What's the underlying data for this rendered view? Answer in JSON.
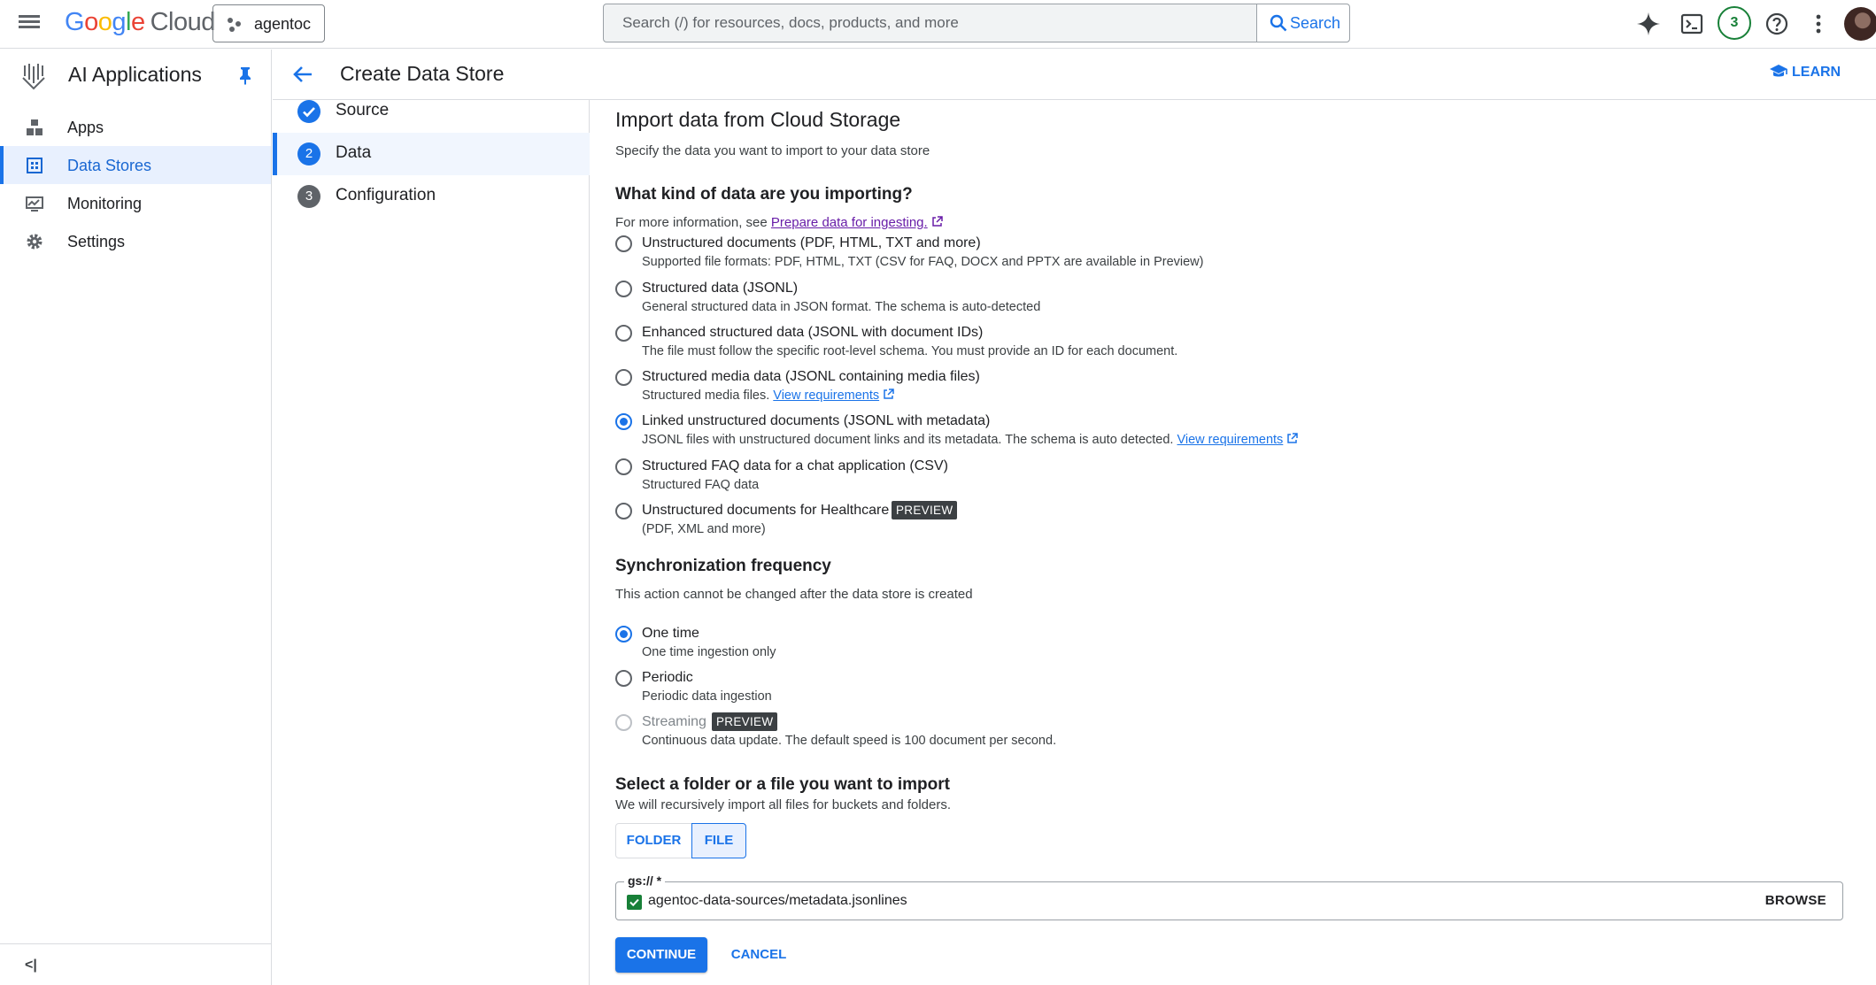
{
  "topbar": {
    "logo": {
      "g": "G",
      "o1": "o",
      "o2": "o",
      "g2": "g",
      "l": "l",
      "e": "e",
      "cloud": "Cloud"
    },
    "project": "agentoc",
    "search_placeholder": "Search (/) for resources, docs, products, and more",
    "search_button": "Search",
    "notifications_count": "3"
  },
  "leftnav": {
    "product_title": "AI Applications",
    "items": [
      {
        "label": "Apps",
        "icon": "apps-icon",
        "active": false
      },
      {
        "label": "Data Stores",
        "icon": "data-stores-icon",
        "active": true
      },
      {
        "label": "Monitoring",
        "icon": "monitoring-icon",
        "active": false
      },
      {
        "label": "Settings",
        "icon": "gear-icon",
        "active": false
      }
    ],
    "collapse": "<|"
  },
  "header": {
    "title": "Create Data Store",
    "learn": "LEARN"
  },
  "steps": [
    {
      "number": "",
      "label": "Source",
      "state": "done"
    },
    {
      "number": "2",
      "label": "Data",
      "state": "active"
    },
    {
      "number": "3",
      "label": "Configuration",
      "state": "todo"
    }
  ],
  "main": {
    "title": "Import data from Cloud Storage",
    "subtitle": "Specify the data you want to import to your data store",
    "kind_heading": "What kind of data are you importing?",
    "kind_info_prefix": "For more information, see ",
    "kind_info_link": "Prepare data for ingesting.",
    "options": [
      {
        "label": "Unstructured documents (PDF, HTML, TXT and more)",
        "desc": "Supported file formats: PDF, HTML, TXT (CSV for FAQ, DOCX and PPTX are available in Preview)",
        "checked": false
      },
      {
        "label": "Structured data (JSONL)",
        "desc": "General structured data in JSON format. The schema is auto-detected",
        "checked": false
      },
      {
        "label": "Enhanced structured data (JSONL with document IDs)",
        "desc": "The file must follow the specific root-level schema. You must provide an ID for each document.",
        "checked": false
      },
      {
        "label": "Structured media data (JSONL containing media files)",
        "desc": "Structured media files. ",
        "link": "View requirements",
        "checked": false
      },
      {
        "label": "Linked unstructured documents (JSONL with metadata)",
        "desc": "JSONL files with unstructured document links and its metadata. The schema is auto detected. ",
        "link": "View requirements",
        "checked": true
      },
      {
        "label": "Structured FAQ data for a chat application (CSV)",
        "desc": "Structured FAQ data",
        "checked": false
      },
      {
        "label": "Unstructured documents for Healthcare",
        "desc": "(PDF, XML and more)",
        "chip": "PREVIEW",
        "checked": false
      }
    ],
    "sync_heading": "Synchronization frequency",
    "sync_desc": "This action cannot be changed after the data store is created",
    "sync_options": [
      {
        "label": "One time",
        "desc": "One time ingestion only",
        "checked": true,
        "disabled": false
      },
      {
        "label": "Periodic",
        "desc": "Periodic data ingestion",
        "checked": false,
        "disabled": false
      },
      {
        "label": "Streaming",
        "desc": "Continuous data update. The default speed is 100 document per second.",
        "chip": "PREVIEW",
        "checked": false,
        "disabled": true
      }
    ],
    "select_heading": "Select a folder or a file you want to import",
    "select_desc": "We will recursively import all files for buckets and folders.",
    "toggle_folder": "FOLDER",
    "toggle_file": "FILE",
    "field_label": "gs:// *",
    "field_value": "agentoc-data-sources/metadata.jsonlines",
    "browse": "BROWSE",
    "continue": "CONTINUE",
    "cancel": "CANCEL"
  },
  "colors": {
    "accent": "#1a73e8",
    "success": "#188038",
    "visited_link": "#681da8"
  }
}
